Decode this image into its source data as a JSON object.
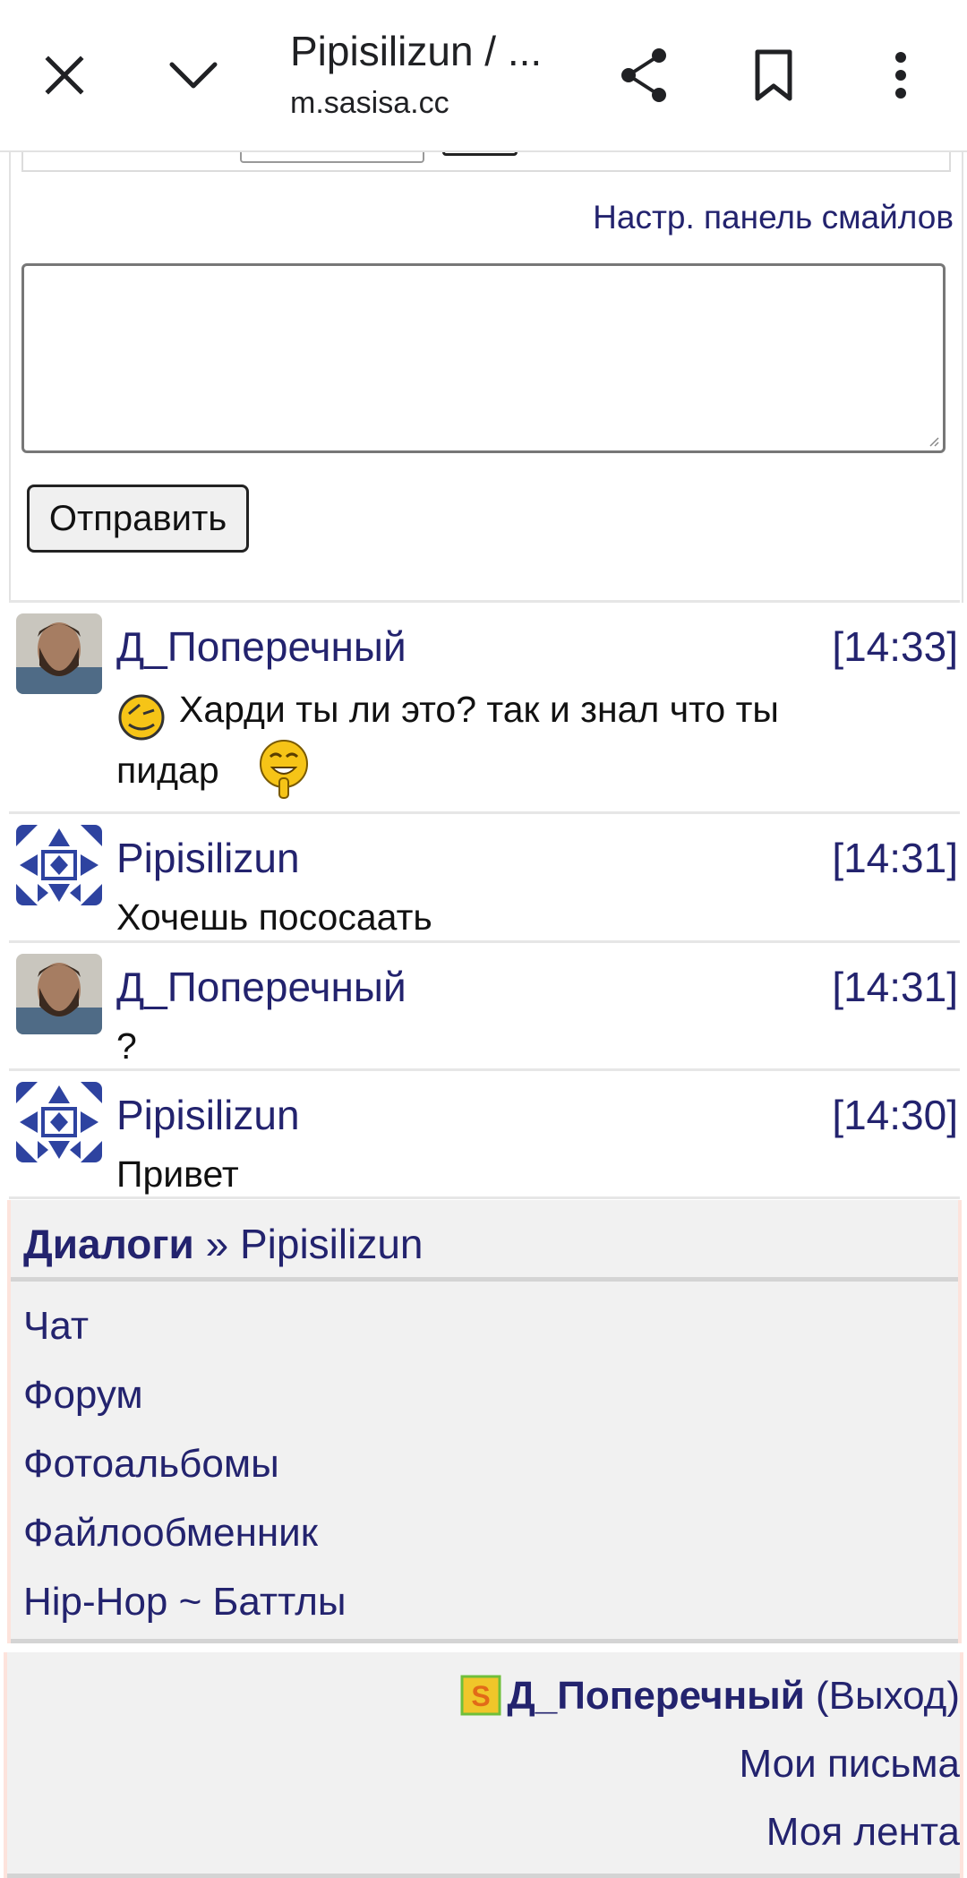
{
  "browser": {
    "title": "Pipisilizun / ...",
    "url": "m.sasisa.cc",
    "icons": [
      "close-icon",
      "chevron-down-icon",
      "share-icon",
      "bookmark-icon",
      "more-vert-icon"
    ]
  },
  "compose": {
    "smiles_link": "Настр. панель смайлов",
    "textarea_value": "",
    "send_label": "Отправить"
  },
  "messages": [
    {
      "user": "Д_Поперечный",
      "time": "[14:33]",
      "text_line1": "Харди ты ли это? так и знал что ты",
      "text_line2": "пидар",
      "avatar": "photo"
    },
    {
      "user": "Pipisilizun",
      "time": "[14:31]",
      "text": "Хочешь пососаать",
      "avatar": "pattern"
    },
    {
      "user": "Д_Поперечный",
      "time": "[14:31]",
      "text": "?",
      "avatar": "photo"
    },
    {
      "user": "Pipisilizun",
      "time": "[14:30]",
      "text": "Привет",
      "avatar": "pattern"
    }
  ],
  "nav": {
    "breadcrumb_root": "Диалоги",
    "breadcrumb_sep": "»",
    "breadcrumb_current": "Pipisilizun",
    "items": [
      "Чат",
      "Форум",
      "Фотоальбомы",
      "Файлообменник",
      "Hip-Hop ~ Баттлы"
    ]
  },
  "user": {
    "name": "Д_Поперечный",
    "logout": "(Выход)",
    "mail": "Мои письма",
    "feed": "Моя лента"
  },
  "colors": {
    "link": "#23236e",
    "nav_bg": "#f1f1f1",
    "accent_border": "#fde3dc"
  }
}
